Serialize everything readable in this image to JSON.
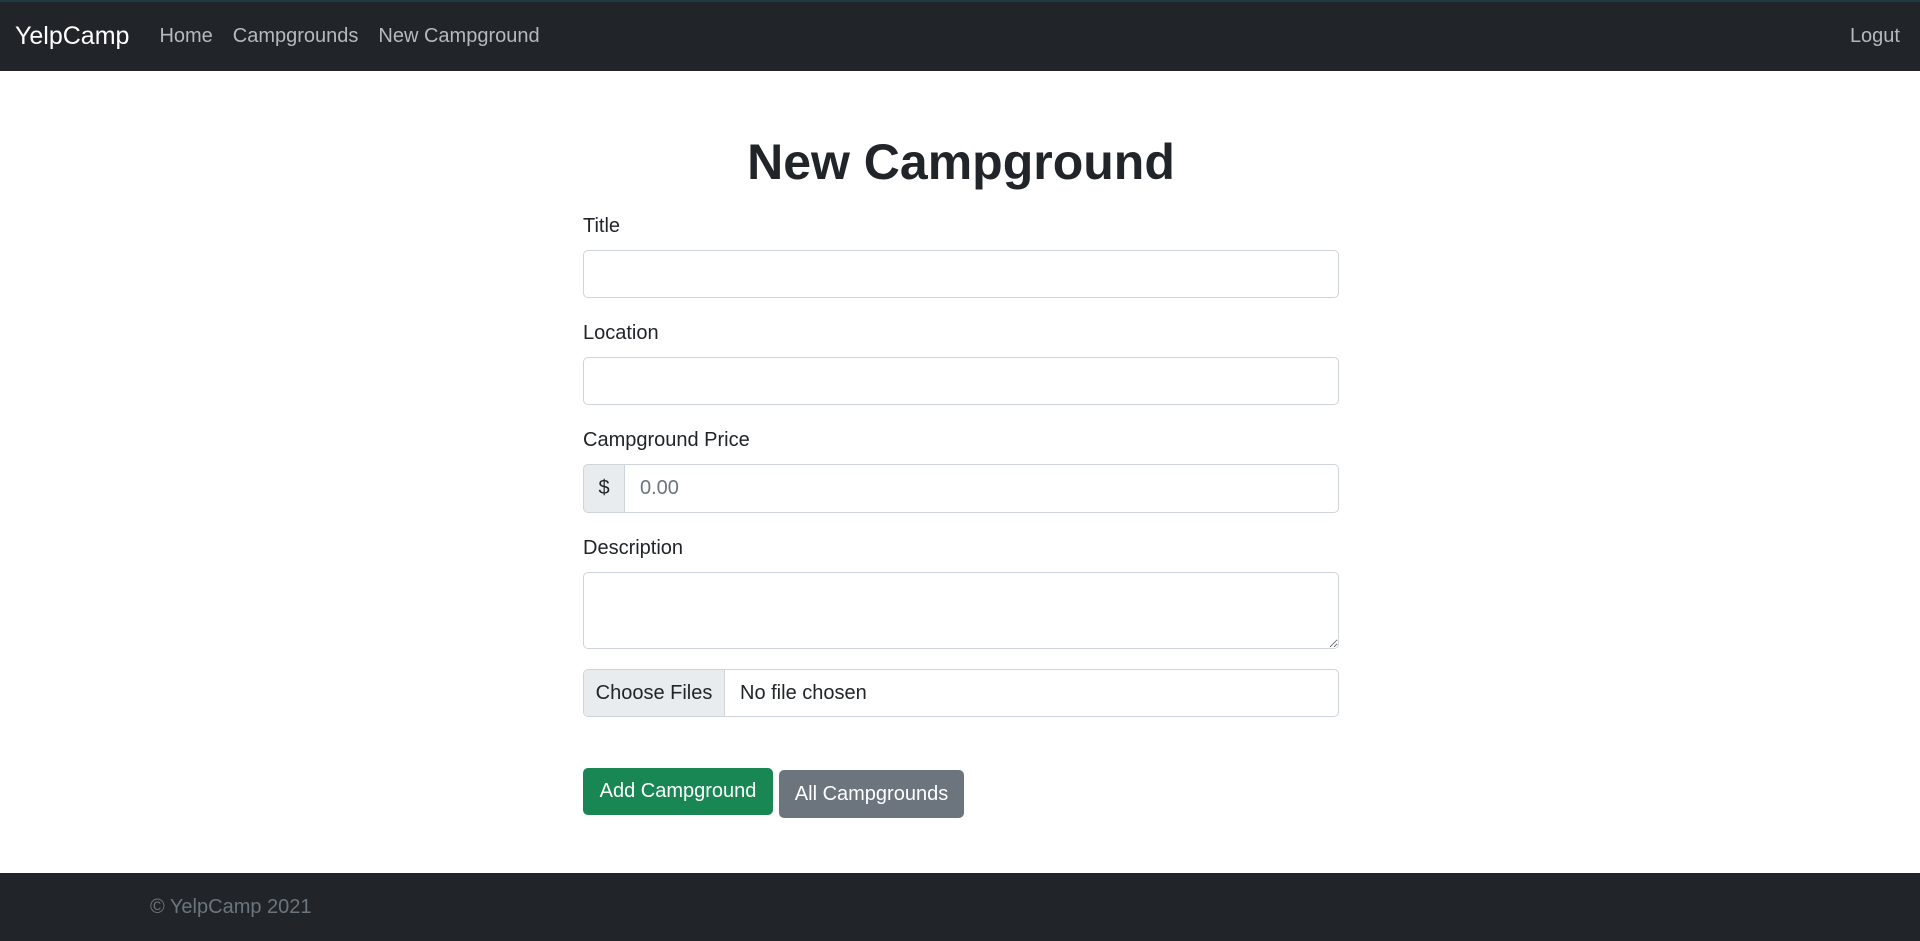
{
  "navbar": {
    "brand": "YelpCamp",
    "links": [
      {
        "label": "Home"
      },
      {
        "label": "Campgrounds"
      },
      {
        "label": "New Campground"
      }
    ],
    "logout_label": "Logut"
  },
  "main": {
    "title": "New Campground",
    "fields": {
      "title_label": "Title",
      "title_value": "",
      "location_label": "Location",
      "location_value": "",
      "price_label": "Campground Price",
      "price_prefix": "$",
      "price_placeholder": "0.00",
      "price_value": "",
      "description_label": "Description",
      "description_value": ""
    },
    "file_input": {
      "button_label": "Choose Files",
      "status_text": "No file chosen"
    },
    "buttons": {
      "add_label": "Add Campground",
      "all_label": "All Campgrounds"
    }
  },
  "footer": {
    "text": "© YelpCamp 2021"
  },
  "colors": {
    "navbar_bg": "#212529",
    "success": "#198754",
    "secondary": "#6c757d"
  }
}
